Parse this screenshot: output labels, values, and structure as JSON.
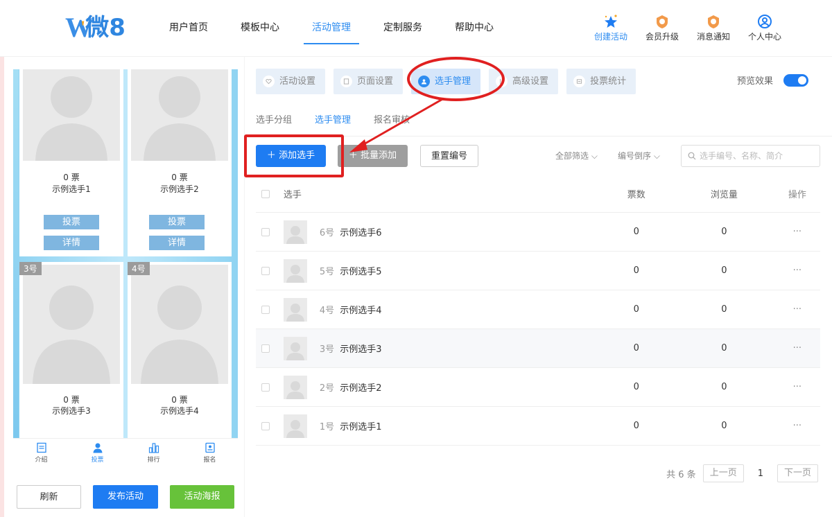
{
  "header": {
    "logo_text": "微8",
    "nav": [
      {
        "label": "用户首页",
        "active": false
      },
      {
        "label": "模板中心",
        "active": false
      },
      {
        "label": "活动管理",
        "active": true
      },
      {
        "label": "定制服务",
        "active": false
      },
      {
        "label": "帮助中心",
        "active": false
      }
    ],
    "actions": [
      {
        "label": "创建活动",
        "icon": "star-sparkle-icon"
      },
      {
        "label": "会员升级",
        "icon": "vip-badge-icon"
      },
      {
        "label": "消息通知",
        "icon": "bell-badge-icon"
      },
      {
        "label": "个人中心",
        "icon": "user-circle-icon"
      }
    ]
  },
  "preview": {
    "cards": [
      {
        "votes": "0 票",
        "name": "示例选手1",
        "vote_btn": "投票",
        "detail_btn": "详情",
        "badge": ""
      },
      {
        "votes": "0 票",
        "name": "示例选手2",
        "vote_btn": "投票",
        "detail_btn": "详情",
        "badge": ""
      },
      {
        "votes": "0 票",
        "name": "示例选手3",
        "badge": "3号"
      },
      {
        "votes": "0 票",
        "name": "示例选手4",
        "badge": "4号"
      }
    ],
    "tabbar": [
      {
        "label": "介绍",
        "icon": "document-icon"
      },
      {
        "label": "投票",
        "icon": "person-icon",
        "active": true
      },
      {
        "label": "排行",
        "icon": "bar-chart-icon"
      },
      {
        "label": "报名",
        "icon": "id-card-icon"
      }
    ],
    "buttons": {
      "refresh": "刷新",
      "publish": "发布活动",
      "poster": "活动海报"
    }
  },
  "main": {
    "tabs": [
      {
        "label": "活动设置",
        "icon": "heart-icon"
      },
      {
        "label": "页面设置",
        "icon": "page-icon"
      },
      {
        "label": "选手管理",
        "icon": "users-icon",
        "active": true
      },
      {
        "label": "高级设置",
        "icon": "sliders-icon"
      },
      {
        "label": "投票统计",
        "icon": "stats-icon"
      }
    ],
    "preview_label": "预览效果",
    "preview_on": true,
    "sub_tabs": [
      {
        "label": "选手分组"
      },
      {
        "label": "选手管理",
        "active": true
      },
      {
        "label": "报名审核"
      }
    ],
    "toolbar": {
      "add": "添加选手",
      "batch": "批量添加",
      "reset": "重置编号",
      "filter": "全部筛选",
      "sort": "编号倒序",
      "search_placeholder": "选手编号、名称、简介"
    },
    "table": {
      "headers": {
        "player": "选手",
        "votes": "票数",
        "views": "浏览量",
        "op": "操作"
      },
      "rows": [
        {
          "num": "6号",
          "name": "示例选手6",
          "votes": "0",
          "views": "0",
          "op": "···"
        },
        {
          "num": "5号",
          "name": "示例选手5",
          "votes": "0",
          "views": "0",
          "op": "···"
        },
        {
          "num": "4号",
          "name": "示例选手4",
          "votes": "0",
          "views": "0",
          "op": "···"
        },
        {
          "num": "3号",
          "name": "示例选手3",
          "votes": "0",
          "views": "0",
          "op": "···"
        },
        {
          "num": "2号",
          "name": "示例选手2",
          "votes": "0",
          "views": "0",
          "op": "···"
        },
        {
          "num": "1号",
          "name": "示例选手1",
          "votes": "0",
          "views": "0",
          "op": "···"
        }
      ]
    },
    "pager": {
      "total": "共 6 条",
      "prev": "上一页",
      "current": "1",
      "next": "下一页"
    }
  },
  "colors": {
    "primary": "#1e7cf2",
    "annotation": "#e02020",
    "green": "#67c23a"
  }
}
